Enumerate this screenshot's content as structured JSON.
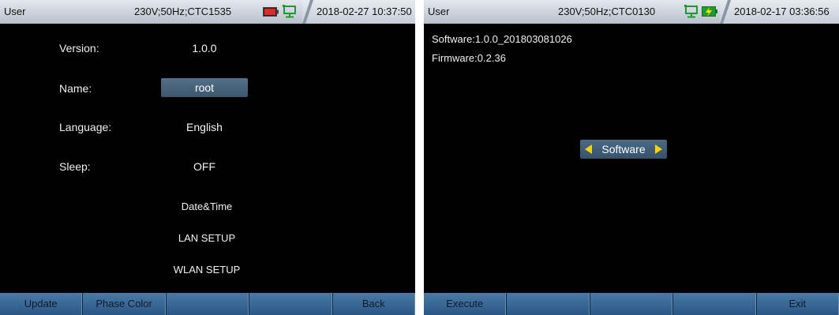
{
  "left": {
    "status": {
      "user": "User",
      "line": "230V;50Hz;CTC1535",
      "datetime": "2018-02-27 10:37:50",
      "icons": [
        "battery-icon",
        "network-icon"
      ]
    },
    "rows": [
      {
        "label": "Version:",
        "value": "1.0.0"
      },
      {
        "label": "Name:",
        "value": "root"
      },
      {
        "label": "Language:",
        "value": "English"
      },
      {
        "label": "Sleep:",
        "value": "OFF"
      }
    ],
    "items": [
      "Date&Time",
      "LAN SETUP",
      "WLAN SETUP"
    ],
    "fkeys": [
      "Update",
      "Phase Color",
      "",
      "",
      "Back"
    ]
  },
  "right": {
    "status": {
      "user": "User",
      "line": "230V;50Hz;CTC0130",
      "datetime": "2018-02-17 03:36:56",
      "icons": [
        "network-icon",
        "charging-battery-icon"
      ]
    },
    "software": "Software:1.0.0_201803081026",
    "firmware": "Firmware:0.2.36",
    "selector": "Software",
    "fkeys": [
      "Execute",
      "",
      "",
      "",
      "Exit"
    ]
  },
  "colors": {
    "accent_button": "#3f5f7c",
    "arrow": "#ffd200",
    "function_key": "#3b6b98"
  }
}
